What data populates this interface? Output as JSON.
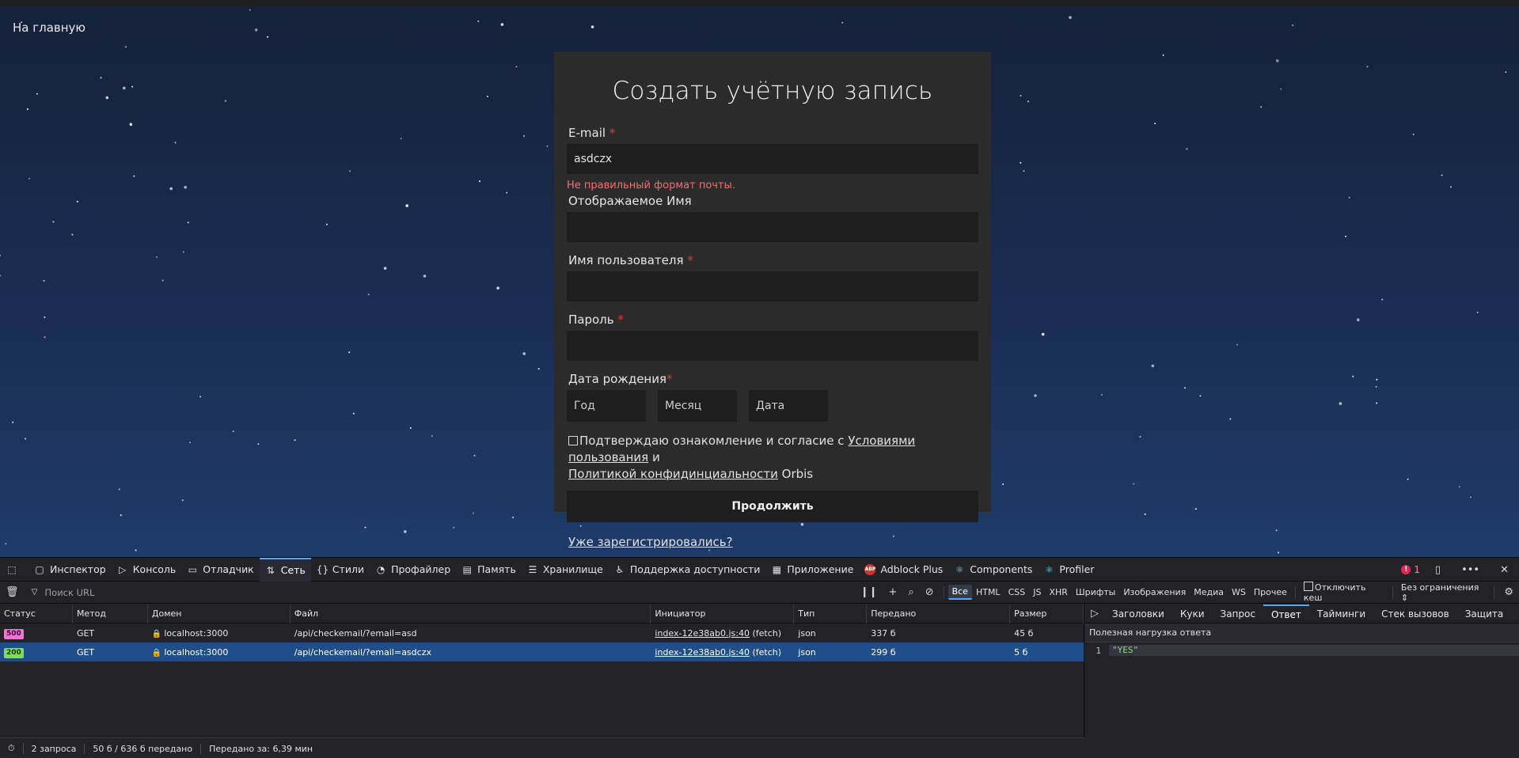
{
  "page": {
    "home_link": "На главную",
    "title": "Создать учётную запись",
    "email": {
      "label": "E-mail",
      "required_mark": "*",
      "value": "asdczx",
      "error": "Не правильный формат почты."
    },
    "display_name": {
      "label": "Отображаемое Имя",
      "value": ""
    },
    "username": {
      "label": "Имя пользователя",
      "required_mark": "*",
      "value": ""
    },
    "password": {
      "label": "Пароль",
      "required_mark": "*",
      "value": ""
    },
    "birthdate": {
      "label": "Дата рождения",
      "required_mark": "*",
      "year": "Год",
      "month": "Месяц",
      "day": "Дата"
    },
    "consent": {
      "text_before": "Подтверждаю ознакомление и согласие с ",
      "terms_link": "Условиями пользования",
      "and": " и ",
      "privacy_link": "Политикой конфидинциальности",
      "text_after": " Orbis"
    },
    "submit_label": "Продолжить",
    "login_link": "Уже зарегистрировались?"
  },
  "devtools": {
    "tabs": [
      {
        "label": "Инспектор",
        "icon": "inspector-icon"
      },
      {
        "label": "Консоль",
        "icon": "console-icon"
      },
      {
        "label": "Отладчик",
        "icon": "debugger-icon"
      },
      {
        "label": "Сеть",
        "icon": "network-icon",
        "active": true
      },
      {
        "label": "Стили",
        "icon": "styles-icon"
      },
      {
        "label": "Профайлер",
        "icon": "profiler-icon"
      },
      {
        "label": "Память",
        "icon": "memory-icon"
      },
      {
        "label": "Хранилище",
        "icon": "storage-icon"
      },
      {
        "label": "Поддержка доступности",
        "icon": "accessibility-icon"
      },
      {
        "label": "Приложение",
        "icon": "application-icon"
      },
      {
        "label": "Adblock Plus",
        "icon": "abp-icon"
      },
      {
        "label": "Components",
        "icon": "react-icon"
      },
      {
        "label": "Profiler",
        "icon": "react-icon"
      }
    ],
    "error_count": "1",
    "abp_icon_text": "ABP",
    "filter_placeholder": "Поиск URL",
    "filter_types": [
      "Все",
      "HTML",
      "CSS",
      "JS",
      "XHR",
      "Шрифты",
      "Изображения",
      "Медиа",
      "WS",
      "Прочее"
    ],
    "disable_cache": "Отключить кеш",
    "throttling": "Без ограничения",
    "columns": [
      "Статус",
      "Метод",
      "Домен",
      "Файл",
      "Инициатор",
      "Тип",
      "Передано",
      "Размер"
    ],
    "requests": [
      {
        "status": "500",
        "method": "GET",
        "domain": "localhost:3000",
        "file": "/api/checkemail/?email=asd",
        "initiator": "index-12e38ab0.js:40",
        "initiator_suffix": " (fetch)",
        "type": "json",
        "transferred": "337 б",
        "size": "45 б"
      },
      {
        "status": "200",
        "method": "GET",
        "domain": "localhost:3000",
        "file": "/api/checkemail/?email=asdczx",
        "initiator": "index-12e38ab0.js:40",
        "initiator_suffix": " (fetch)",
        "type": "json",
        "transferred": "299 б",
        "size": "5 б"
      }
    ],
    "detail_tabs": [
      "Заголовки",
      "Куки",
      "Запрос",
      "Ответ",
      "Тайминги",
      "Стек вызовов",
      "Защита"
    ],
    "active_detail_tab": "Ответ",
    "payload_title": "Полезная нагрузка ответа",
    "payload_line_no": "1",
    "payload_value": "\"YES\"",
    "summary": {
      "requests": "2 запроса",
      "transferred": "50 б / 636 б передано",
      "finished": "Передано за: 6,39 мин"
    }
  }
}
